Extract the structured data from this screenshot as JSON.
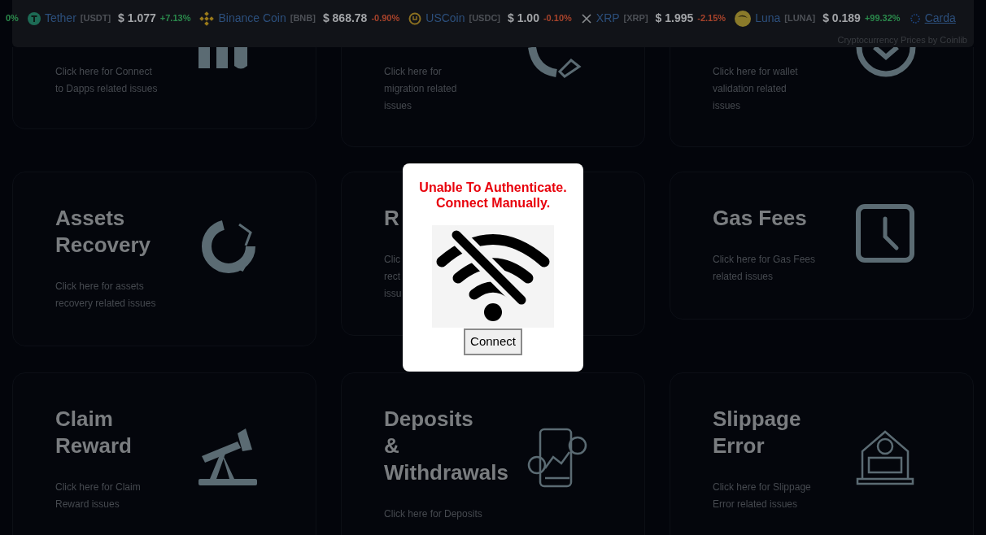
{
  "ticker": {
    "items": [
      {
        "change": "0%",
        "color": "#2b8a4c"
      },
      {
        "name": "Tether",
        "symbol": "[USDT]",
        "price": "$ 1.077",
        "change": "+7.13%",
        "color": "#2b8a4c"
      },
      {
        "name": "Binance Coin",
        "symbol": "[BNB]",
        "price": "$ 868.78",
        "change": "-0.90%",
        "color": "#a8432b"
      },
      {
        "name": "USCoin",
        "symbol": "[USDC]",
        "price": "$ 1.00",
        "change": "-0.10%",
        "color": "#a8432b"
      },
      {
        "name": "XRP",
        "symbol": "[XRP]",
        "price": "$ 1.995",
        "change": "-2.15%",
        "color": "#a8432b"
      },
      {
        "name": "Luna",
        "symbol": "[LUNA]",
        "price": "$ 0.189",
        "change": "+99.32%",
        "color": "#2b8a4c"
      },
      {
        "name": "Carda"
      }
    ],
    "credit": "Cryptocurrency Prices by Coinlib"
  },
  "cards": [
    {
      "description_lines": [
        "Click here for Connect",
        "to Dapps related issues"
      ]
    },
    {
      "description_lines": [
        "Click here for",
        "migration related",
        "issues"
      ]
    },
    {
      "description_lines": [
        "Click here for wallet",
        "validation related",
        "issues"
      ]
    },
    {
      "title_lines": [
        "Assets",
        "Recovery"
      ],
      "description_lines": [
        "Click here for assets",
        "recovery related issues"
      ]
    },
    {
      "title_lines": [
        "R"
      ],
      "description_lines": [
        "Clic",
        "rect",
        "issu"
      ]
    },
    {
      "title_lines": [
        "Gas Fees"
      ],
      "description_lines": [
        "Click here for Gas Fees",
        "related issues"
      ]
    },
    {
      "title_lines": [
        "Claim",
        "Reward"
      ],
      "description_lines": [
        "Click here for Claim",
        "Reward issues"
      ]
    },
    {
      "title_lines": [
        "Deposits",
        "&",
        "Withdrawals"
      ],
      "description_lines": [
        "Click here for Deposits"
      ]
    },
    {
      "title_lines": [
        "Slippage",
        "Error"
      ],
      "description_lines": [
        "Click here for Slippage",
        "Error related issues"
      ]
    }
  ],
  "modal": {
    "title_lines": [
      "Unable To Authenticate.",
      "Connect Manually."
    ],
    "button": "Connect"
  }
}
